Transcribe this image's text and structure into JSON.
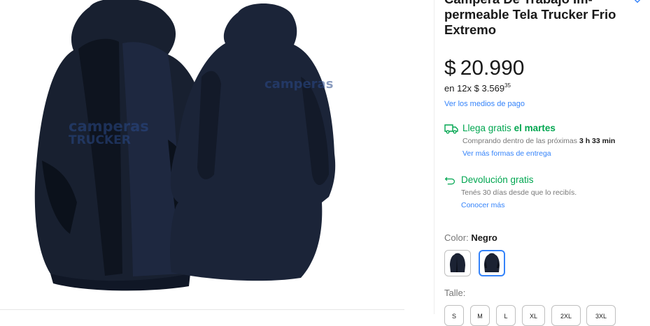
{
  "product": {
    "title": "Campera De Trabajo Impermeable Tela Trucker Frio Extremo",
    "title_lines": [
      "Campera De Trabajo Im-",
      "permeable Tela Trucker Frio",
      "Extremo"
    ],
    "gallery_watermark_front": [
      "camperas",
      "TRUCKER"
    ],
    "gallery_watermark_back": "camperas"
  },
  "price": {
    "currency": "$",
    "amount": "20.990",
    "installments_prefix": "en 12x",
    "installment_amount": "$ 3.569",
    "installment_cents": "35",
    "payment_link": "Ver los medios de pago"
  },
  "shipping": {
    "icon": "truck-icon",
    "text_prefix": "Llega gratis",
    "text_day": "el martes",
    "sub_prefix": "Comprando dentro de las próximas",
    "sub_time": "3 h 33 min",
    "link": "Ver más formas de entrega"
  },
  "returns": {
    "icon": "return-arrow-icon",
    "text": "Devolución gratis",
    "sub": "Tenés 30 días desde que lo recibís.",
    "link": "Conocer más"
  },
  "variants": {
    "color_label": "Color:",
    "color_value": "Negro",
    "swatches": [
      "jacket-front-thumbnail",
      "jacket-back-thumbnail"
    ],
    "selected_swatch": 1,
    "size_label": "Talle:",
    "sizes": [
      "S",
      "M",
      "L",
      "XL",
      "2XL",
      "3XL"
    ]
  },
  "colors": {
    "accent": "#3483fa",
    "green": "#00a650",
    "jacket": "#1b2233"
  }
}
